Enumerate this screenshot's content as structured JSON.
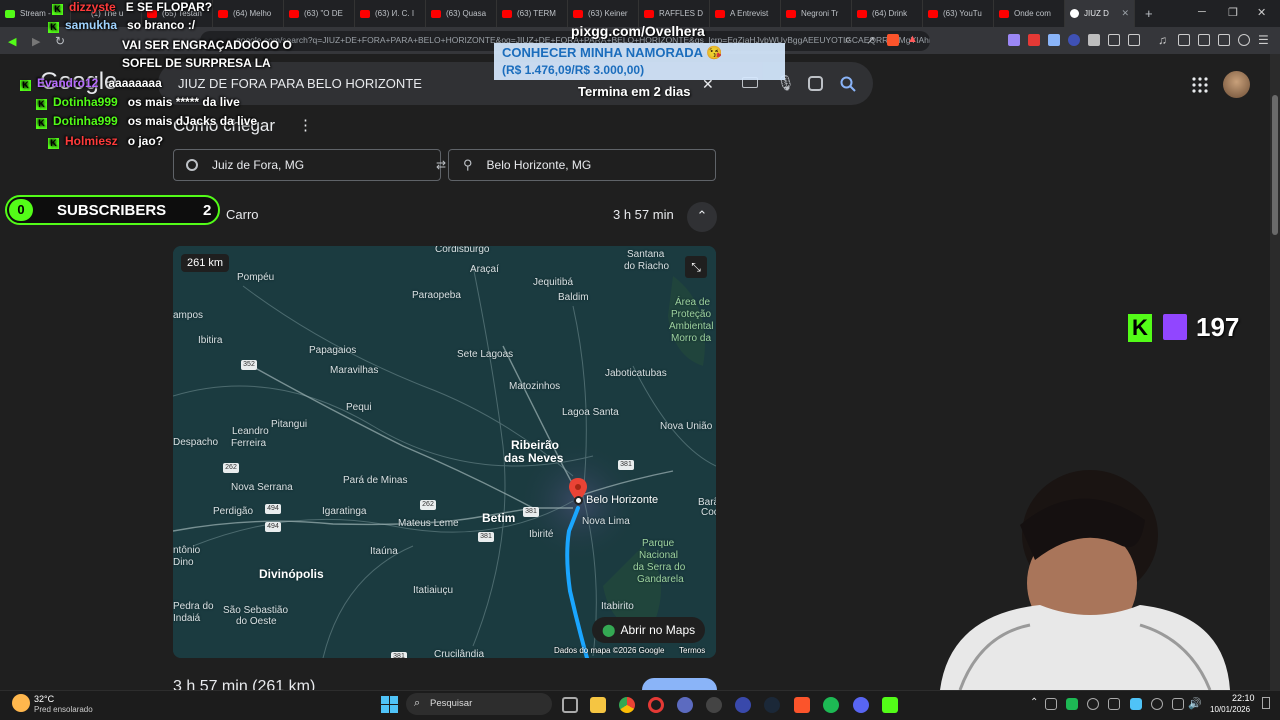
{
  "browser": {
    "tabs": [
      {
        "label": "Stream -",
        "color": "#53fc18"
      },
      {
        "label": "(1) The u",
        "color": "#222"
      },
      {
        "label": "(65) Testan",
        "color": "#ff0000"
      },
      {
        "label": "(64) Melho",
        "color": "#ff0000"
      },
      {
        "label": "(63) \"O DE",
        "color": "#ff0000"
      },
      {
        "label": "(63) И. С. I",
        "color": "#ff0000"
      },
      {
        "label": "(63) Quasa",
        "color": "#ff0000"
      },
      {
        "label": "(63) TERM",
        "color": "#ff0000"
      },
      {
        "label": "(63) Keiner",
        "color": "#ff0000"
      },
      {
        "label": "RAFFLES D",
        "color": "#ff0000"
      },
      {
        "label": "A Entrevist",
        "color": "#ff0000"
      },
      {
        "label": "Negroni Tr",
        "color": "#ff0000"
      },
      {
        "label": "(64) Drink",
        "color": "#ff0000"
      },
      {
        "label": "(63) YouTu",
        "color": "#ff0000"
      },
      {
        "label": "Onde com",
        "color": "#ff0000"
      }
    ],
    "active_tab": "JIUZ D",
    "url": "google.com/search?q=JIUZ+DE+FORA+PARA+BELO+HORIZONTE&oq=JIUZ+DE+FORA+PARA+BELO+HORIZONTE&gs_lcrp=EgZjaHJvbWUyBggAEEUYOTIGCAEQRRhAMgYIAhBFGECSAQ"
  },
  "google": {
    "logo": "Google",
    "query": "JIUZ DE FORA PARA BELO HORIZONTE",
    "section_title": "Como chegar",
    "origin": "Juiz de Fora, MG",
    "destination": "Belo Horizonte, MG",
    "mode_label": "Carro",
    "duration": "3 h 57 min",
    "distance_badge": "261 km",
    "open_maps": "Abrir no Maps",
    "map_credit": "Dados do mapa ©2026 Google",
    "terms": "Termos",
    "summary_cutoff": "3 h 57 min (261 km)"
  },
  "map_labels": {
    "cordisburgo": "Cordisburgo",
    "santana": "Santana",
    "do_riacho": "do Riacho",
    "araçai": "Araçaí",
    "pompeu": "Pompéu",
    "jequitiba": "Jequitibá",
    "baldim": "Baldim",
    "paraopeba": "Paraopeba",
    "campos": "ampos",
    "area1": "Área de",
    "area2": "Proteção",
    "area3": "Ambiental",
    "area4": "Morro da",
    "ibitira": "Ibitira",
    "papagaios": "Papagaios",
    "sete_lagoas": "Sete Lagoas",
    "maravilhas": "Maravilhas",
    "matozinhos": "Matozinhos",
    "jaboticatubas": "Jaboticatubas",
    "pequi": "Pequi",
    "lagoa_santa": "Lagoa Santa",
    "leandro": "Leandro",
    "ferreira": "Ferreira",
    "pitangui": "Pitangui",
    "nova_uniao": "Nova União",
    "despacho": "Despacho",
    "ribeirao": "Ribeirão",
    "das_neves": "das Neves",
    "nova_serrana": "Nova Serrana",
    "para_de_minas": "Pará de Minas",
    "belo_horizonte": "Belo Horizonte",
    "perdigao": "Perdigão",
    "igaratinga": "Igaratinga",
    "mateus_leme": "Mateus Leme",
    "betim": "Betim",
    "nova_lima": "Nova Lima",
    "barao": "Barã",
    "coc": "Coc",
    "ibirite": "Ibirité",
    "parque1": "Parque",
    "parque2": "Nacional",
    "parque3": "da Serra do",
    "parque4": "Gandarela",
    "antonio": "ntônio",
    "dino": "Dino",
    "itauna": "Itaúna",
    "divinopolis": "Divinópolis",
    "itatiaiucu": "Itatiaiuçu",
    "itabirito": "Itabirito",
    "pedra_do": "Pedra do",
    "indaia": "Indaiá",
    "sao_sebastiao": "São Sebastião",
    "do_oeste": "do Oeste",
    "crucilandia": "Crucilândia",
    "r352": "352",
    "r262a": "262",
    "r262b": "262",
    "r494a": "494",
    "r494b": "494",
    "r381a": "381",
    "r381b": "381",
    "r381c": "381",
    "r381d": "381"
  },
  "stream_overlay": {
    "chat": [
      {
        "user": "dizzyste",
        "msg": "E SE FLOPAR?",
        "color": "#ff3b3b"
      },
      {
        "user": "samukha",
        "msg": "so branco :/",
        "color": "#9fd3ff"
      },
      {
        "user": "",
        "msg": "VAI SER ENGRAÇADOOOO O",
        "color": "#fff"
      },
      {
        "user": "",
        "msg": "SOFEL DE SURPRESA LA",
        "color": "#fff"
      },
      {
        "user": "Evandro12",
        "msg": "aaaaaaaa",
        "color": "#b76bff"
      },
      {
        "user": "Dotinha999",
        "msg": "os mais ***** da live",
        "color": "#53fc18"
      },
      {
        "user": "Dotinha999",
        "msg": "os mais dJacks da live",
        "color": "#53fc18"
      },
      {
        "user": "Holmiesz",
        "msg": "o jao?",
        "color": "#ff3b3b"
      }
    ],
    "promo_site": "pixgg.com/Ovelhera",
    "promo_goal": "CONHECER MINHA NAMORADA 😘",
    "promo_amount": "(R$ 1.476,09/R$ 3.000,00)",
    "promo_ends": "Termina em 2 dias",
    "subs_count": "0",
    "subs_label": "SUBSCRIBERS",
    "subs_extra": "2",
    "viewer_count": "197"
  },
  "taskbar": {
    "weather_temp": "32°C",
    "weather_desc": "Pred ensolarado",
    "search": "Pesquisar",
    "time": "22:10",
    "date": "10/01/2026"
  },
  "colors": {
    "kick": "#53fc18",
    "twitch": "#9146ff",
    "route": "#1aa6ff",
    "pin": "#ea4335"
  }
}
